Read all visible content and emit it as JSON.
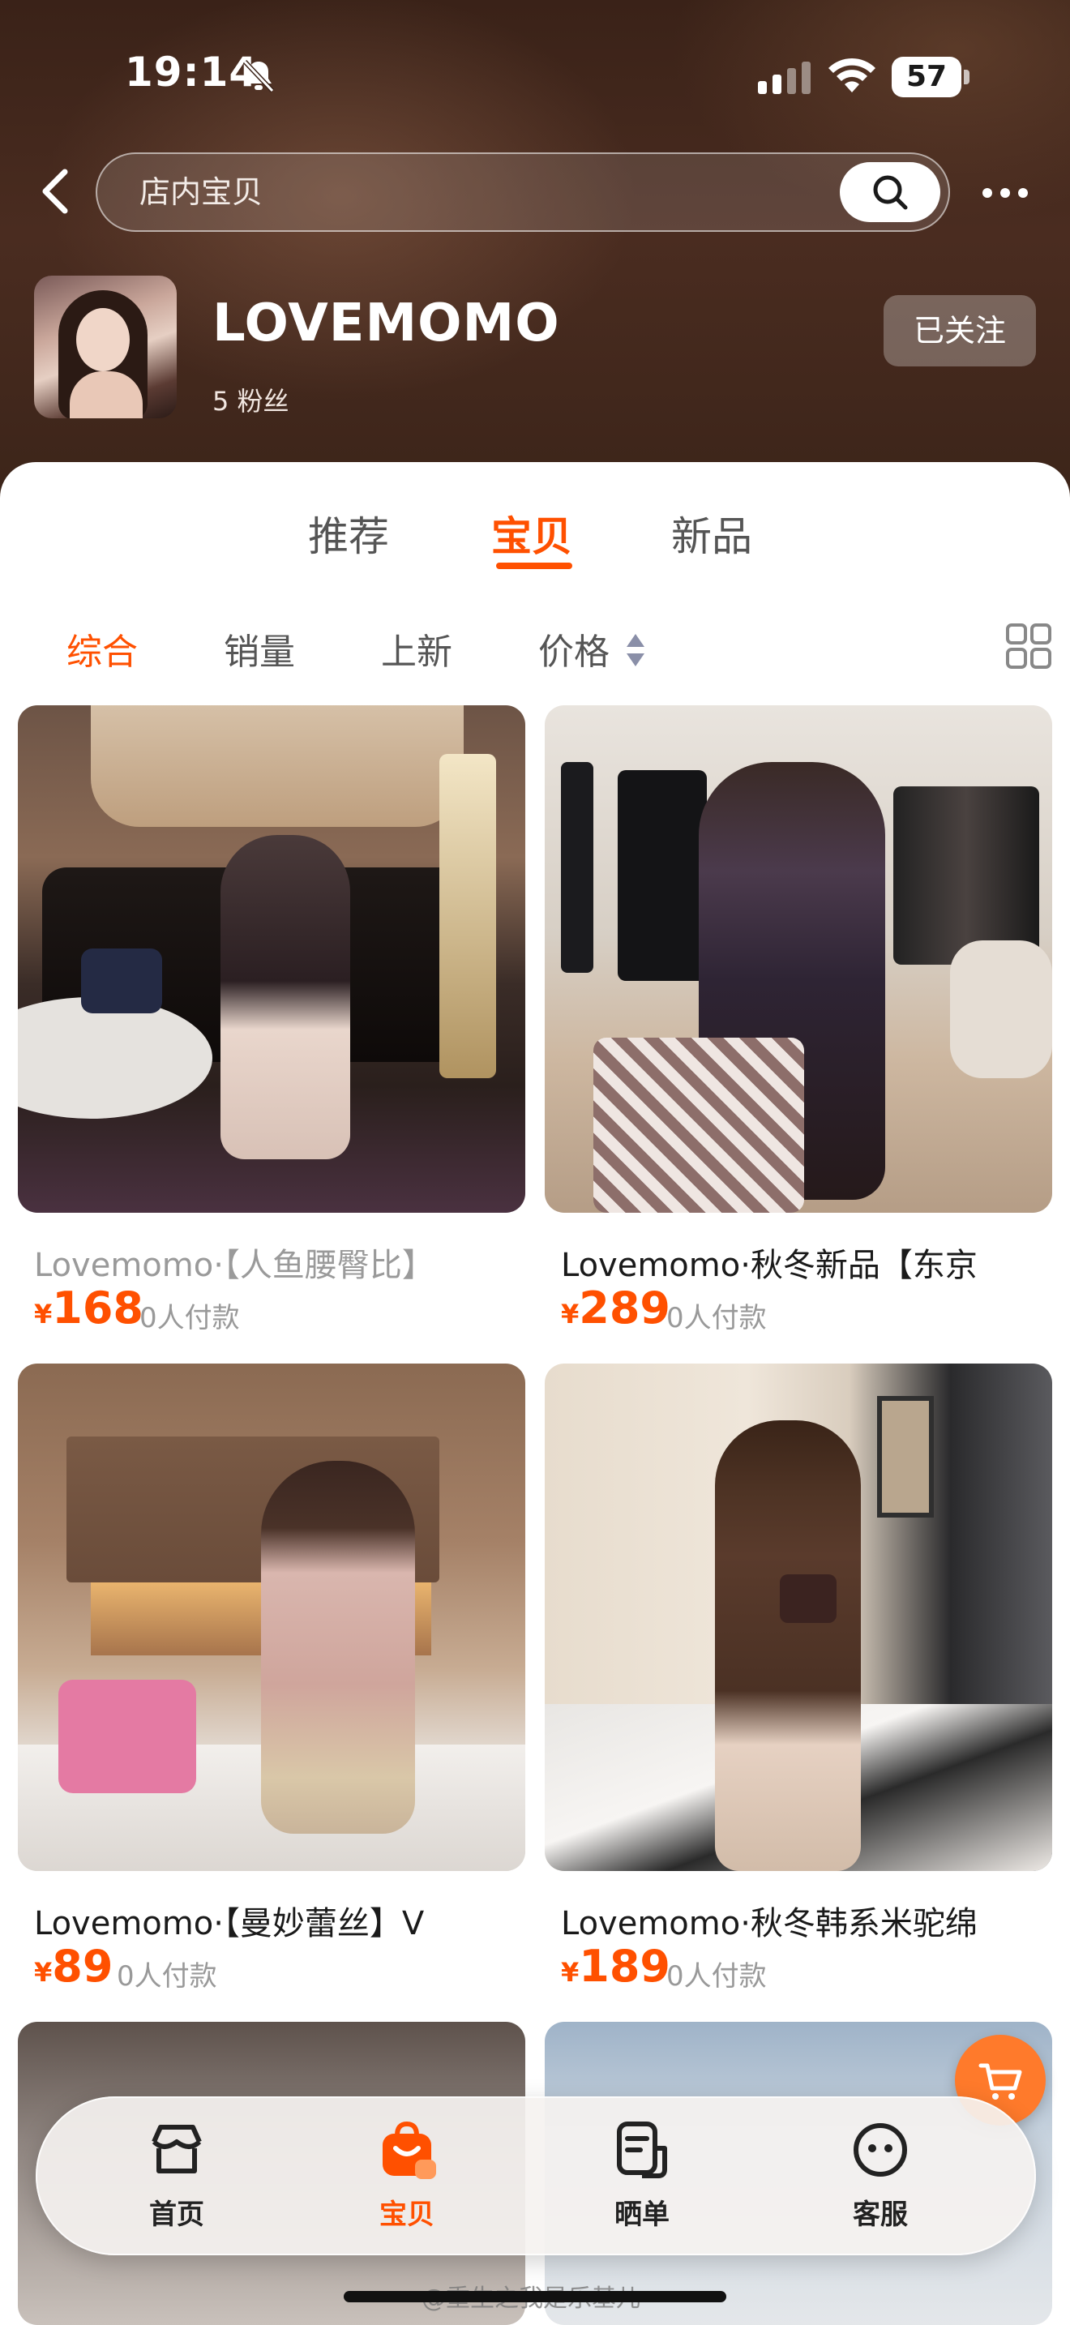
{
  "status_bar": {
    "time": "19:14",
    "battery": "57"
  },
  "search": {
    "placeholder": "店内宝贝"
  },
  "shop": {
    "name": "LOVEMOMO",
    "fans": "5 粉丝",
    "follow_label": "已关注"
  },
  "tabs": [
    {
      "label": "推荐",
      "active": false
    },
    {
      "label": "宝贝",
      "active": true
    },
    {
      "label": "新品",
      "active": false
    }
  ],
  "sort": [
    {
      "label": "综合",
      "active": true
    },
    {
      "label": "销量",
      "active": false
    },
    {
      "label": "上新",
      "active": false
    },
    {
      "label": "价格",
      "active": false
    }
  ],
  "products": [
    {
      "title": "Lovemomo·【人鱼腰臀比】",
      "currency": "¥",
      "price": "168",
      "sales": "0人付款"
    },
    {
      "title": "Lovemomo·秋冬新品【东京",
      "currency": "¥",
      "price": "289",
      "sales": "0人付款"
    },
    {
      "title": "Lovemomo·【曼妙蕾丝】V",
      "currency": "¥",
      "price": "89",
      "sales": "0人付款"
    },
    {
      "title": "Lovemomo·秋冬韩系米驼绵",
      "currency": "¥",
      "price": "189",
      "sales": "0人付款"
    }
  ],
  "bottom_nav": [
    {
      "label": "首页",
      "icon": "shop-icon",
      "active": false
    },
    {
      "label": "宝贝",
      "icon": "bag-icon",
      "active": true
    },
    {
      "label": "晒单",
      "icon": "review-icon",
      "active": false
    },
    {
      "label": "客服",
      "icon": "service-icon",
      "active": false
    }
  ],
  "watermark": "@重生之我是乐基儿",
  "colors": {
    "accent": "#ff5000",
    "header_bg": "#3a2218"
  }
}
